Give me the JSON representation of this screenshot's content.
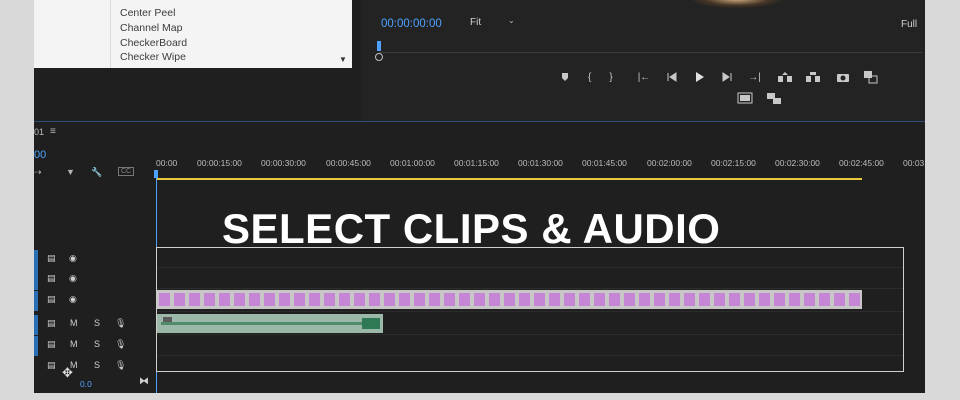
{
  "effects_list": {
    "items": [
      "Center Peel",
      "Channel Map",
      "CheckerBoard",
      "Checker Wipe"
    ]
  },
  "program_monitor": {
    "timecode": "00:00:00:00",
    "fit": "Fit",
    "resolution": "Full",
    "icons": [
      "add-marker-icon",
      "mark-in-icon",
      "mark-out-icon",
      "go-to-in-icon",
      "step-back-icon",
      "play-icon",
      "step-forward-icon",
      "go-to-out-icon",
      "lift-icon",
      "extract-icon",
      "export-frame-icon",
      "compare-icon",
      "safe-margins-icon",
      "multi-camera-icon"
    ]
  },
  "timeline": {
    "sequence_tab": "01",
    "sequence_timecode": "00",
    "ruler_labels": [
      "00:00",
      "00:00:15:00",
      "00:00:30:00",
      "00:00:45:00",
      "00:01:00:00",
      "00:01:15:00",
      "00:01:30:00",
      "00:01:45:00",
      "00:02:00:00",
      "00:02:15:00",
      "00:02:30:00",
      "00:02:45:00",
      "00:03"
    ],
    "headline": "SELECT CLIPS & AUDIO",
    "video_tracks": [
      {
        "toggle_icon": "film-icon",
        "visibility_icon": "eye-icon"
      },
      {
        "toggle_icon": "film-icon",
        "visibility_icon": "eye-icon"
      },
      {
        "toggle_icon": "film-icon",
        "visibility_icon": "eye-icon"
      }
    ],
    "audio_tracks": [
      {
        "mute": "M",
        "solo": "S",
        "mic_icon": "mic-icon"
      },
      {
        "mute": "M",
        "solo": "S",
        "mic_icon": "mic-icon"
      },
      {
        "mute": "M",
        "solo": "S",
        "mic_icon": "mic-icon"
      }
    ],
    "zoom_value": "0.0",
    "accent_color": "#4ea1ff",
    "work_area_color": "#e8c93a",
    "video_clip_frame_color": "#c586d6",
    "video_clip_frame_count": 47
  }
}
